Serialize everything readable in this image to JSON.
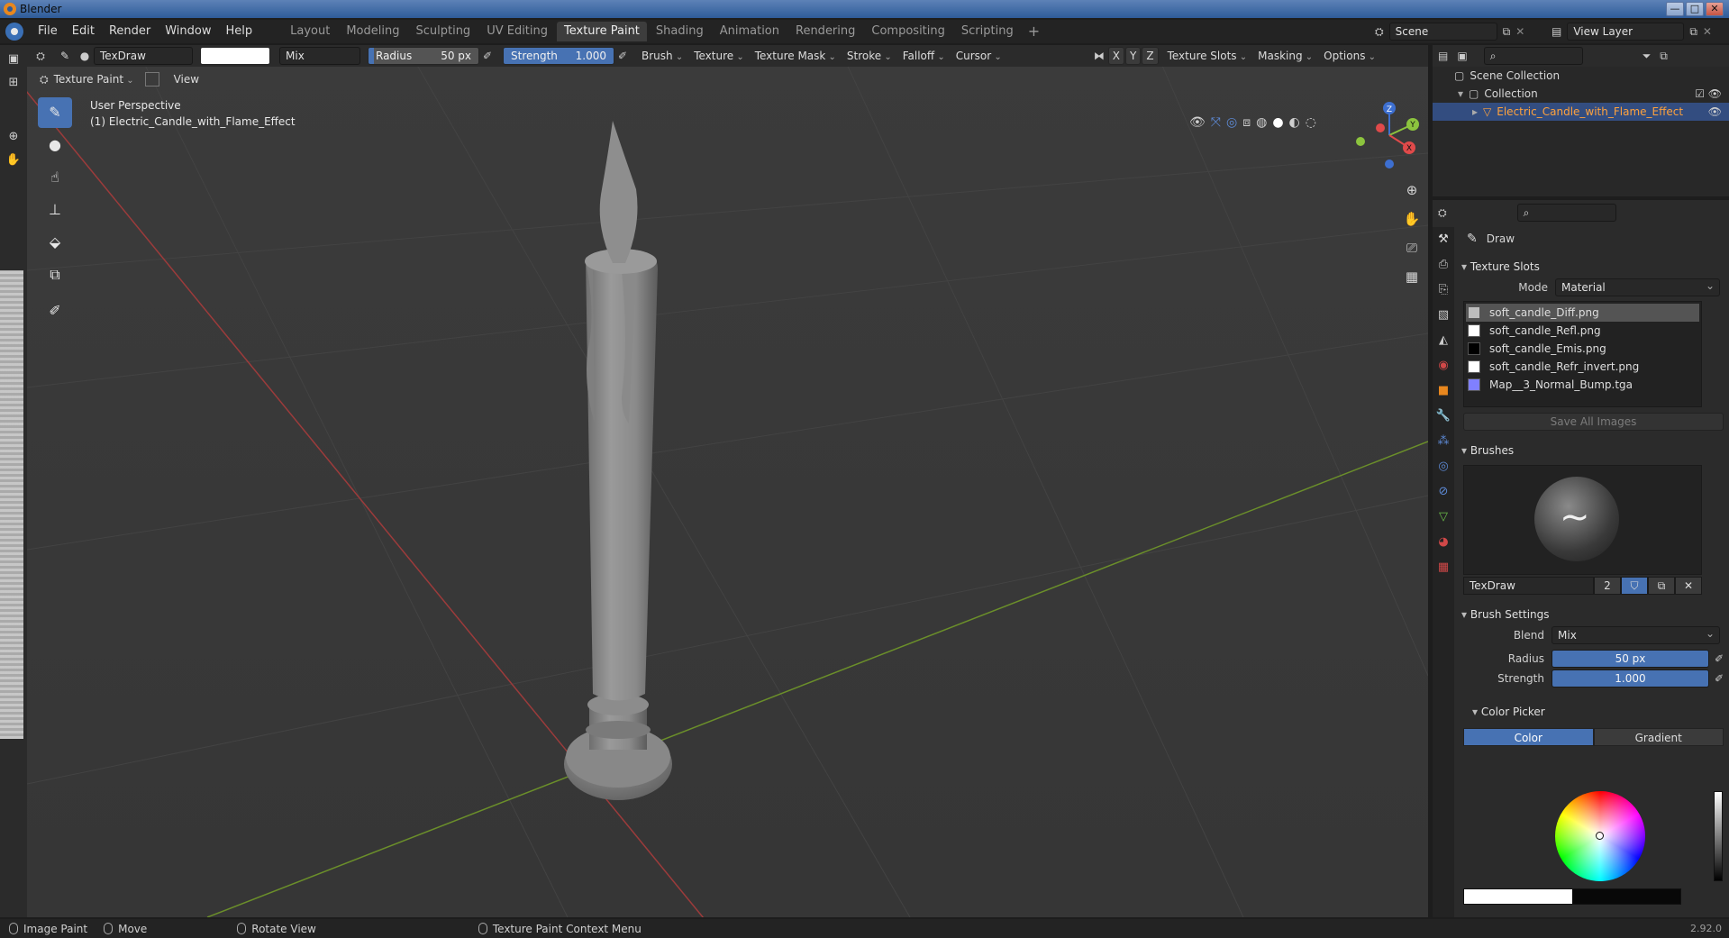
{
  "window": {
    "title": "Blender",
    "buttons": [
      "—",
      "□",
      "✕"
    ]
  },
  "menu": [
    "File",
    "Edit",
    "Render",
    "Window",
    "Help"
  ],
  "workspaces": [
    "Layout",
    "Modeling",
    "Sculpting",
    "UV Editing",
    "Texture Paint",
    "Shading",
    "Animation",
    "Rendering",
    "Compositing",
    "Scripting"
  ],
  "active_workspace": "Texture Paint",
  "scene": {
    "label": "Scene",
    "view_layer": "View Layer"
  },
  "tool_header": {
    "brush_name": "TexDraw",
    "blend": "Mix",
    "radius_label": "Radius",
    "radius_value": "50 px",
    "strength_label": "Strength",
    "strength_value": "1.000",
    "brush": "Brush",
    "texture": "Texture",
    "texture_mask": "Texture Mask",
    "stroke": "Stroke",
    "falloff": "Falloff",
    "cursor": "Cursor",
    "axis": [
      "X",
      "Y",
      "Z"
    ],
    "texture_slots": "Texture Slots",
    "masking": "Masking",
    "options": "Options"
  },
  "mode_header": {
    "mode": "Texture Paint",
    "view": "View"
  },
  "viewport": {
    "perspective": "User Perspective",
    "object": "(1) Electric_Candle_with_Flame_Effect",
    "gizmo": {
      "x": "X",
      "y": "Y",
      "z": "Z"
    }
  },
  "outliner": {
    "root": "Scene Collection",
    "collection": "Collection",
    "object": "Electric_Candle_with_Flame_Effect"
  },
  "properties": {
    "tool_name": "Draw",
    "texture_slots": {
      "title": "Texture Slots",
      "mode_label": "Mode",
      "mode_value": "Material",
      "items": [
        {
          "name": "soft_candle_Diff.png",
          "color": "#bdbdbd"
        },
        {
          "name": "soft_candle_Refl.png",
          "color": "#ffffff"
        },
        {
          "name": "soft_candle_Emis.png",
          "color": "#000000"
        },
        {
          "name": "soft_candle_Refr_invert.png",
          "color": "#ffffff"
        },
        {
          "name": "Map__3_Normal_Bump.tga",
          "color": "#8080ff"
        }
      ],
      "save_all": "Save All Images"
    },
    "brushes": {
      "title": "Brushes",
      "name": "TexDraw",
      "users": "2"
    },
    "brush_settings": {
      "title": "Brush Settings",
      "blend_label": "Blend",
      "blend_value": "Mix",
      "radius_label": "Radius",
      "radius_value": "50 px",
      "strength_label": "Strength",
      "strength_value": "1.000"
    },
    "color_picker": {
      "title": "Color Picker",
      "tab_color": "Color",
      "tab_gradient": "Gradient"
    }
  },
  "status_bar": {
    "left": "Image Paint",
    "move": "Move",
    "rotate": "Rotate View",
    "context": "Texture Paint Context Menu",
    "version": "2.92.0"
  },
  "colors": {
    "accent": "#4772b3",
    "selected_object": "#ffa23d",
    "grid_x_axis": "#9c3b3b",
    "grid_y_axis": "#6b8f2a"
  }
}
